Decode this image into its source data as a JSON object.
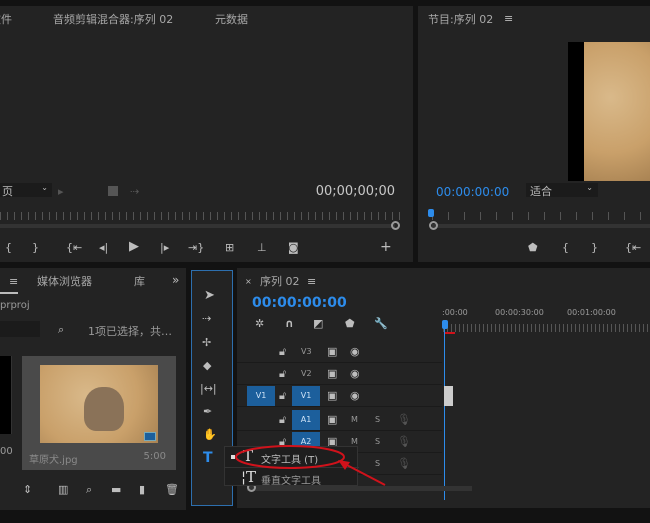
{
  "source_panel": {
    "tabs": [
      "文件",
      "音频剪辑混合器:序列 02",
      "元数据"
    ],
    "page_select": "页",
    "timecode": "00;00;00;00"
  },
  "program_panel": {
    "title": "节目:序列 02",
    "timecode": "00:00:00:00",
    "fit_select": "适合"
  },
  "project_panel": {
    "tabs": [
      "媒体浏览器",
      "库"
    ],
    "project_file": "prproj",
    "selection_status": "1项已选择，共…",
    "clip_name": "草原犬.jpg",
    "clip_duration": "5:00",
    "left_clip_duration": "00"
  },
  "timeline": {
    "tab": "序列 02",
    "timecode": "00:00:00:00",
    "ruler_labels": [
      ":00:00",
      "00:00:30:00",
      "00:01:00:00"
    ],
    "video_tracks": [
      "V3",
      "V2",
      "V1"
    ],
    "source_patch": "V1",
    "audio_tracks": [
      "A1",
      "A2"
    ],
    "mute_label": "M",
    "solo_label": "S"
  },
  "tool_flyout": {
    "items": [
      "文字工具 (T)",
      "垂直文字工具"
    ]
  },
  "colors": {
    "accent": "#2d8ceb",
    "annotation": "#d0121b",
    "panel": "#232323"
  }
}
